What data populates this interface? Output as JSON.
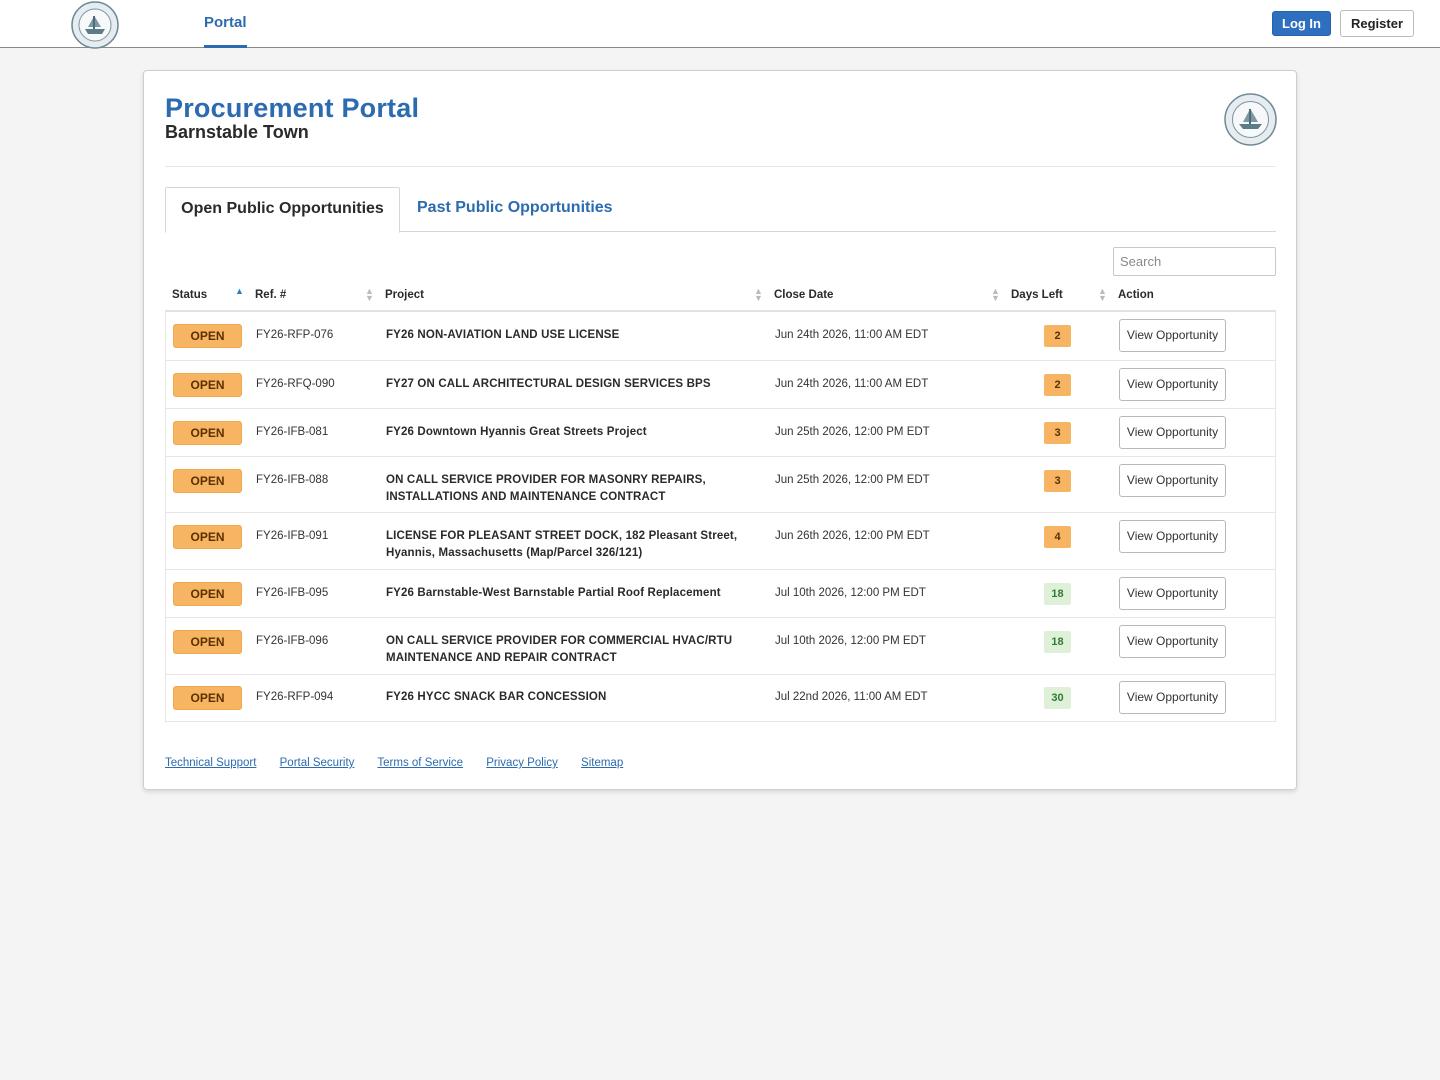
{
  "nav": {
    "portal_label": "Portal",
    "login_label": "Log In",
    "register_label": "Register"
  },
  "header": {
    "title": "Procurement Portal",
    "subtitle": "Barnstable Town"
  },
  "tabs": [
    {
      "label": "Open Public Opportunities",
      "active": true
    },
    {
      "label": "Past Public Opportunities",
      "active": false
    }
  ],
  "search": {
    "placeholder": "Search",
    "value": ""
  },
  "table": {
    "columns": [
      "Status",
      "Ref. #",
      "Project",
      "Close Date",
      "Days Left",
      "Action"
    ],
    "sorted_column": "Status",
    "rows": [
      {
        "status": "OPEN",
        "ref": "FY26-RFP-076",
        "project": "FY26 NON-AVIATION LAND USE LICENSE",
        "close_date": "Jun 24th 2026, 11:00 AM EDT",
        "days_left": "2",
        "action": "View Opportunity"
      },
      {
        "status": "OPEN",
        "ref": "FY26-RFQ-090",
        "project": "FY27 ON CALL ARCHITECTURAL DESIGN SERVICES BPS",
        "close_date": "Jun 24th 2026, 11:00 AM EDT",
        "days_left": "2",
        "action": "View Opportunity"
      },
      {
        "status": "OPEN",
        "ref": "FY26-IFB-081",
        "project": "FY26 Downtown Hyannis Great Streets Project",
        "close_date": "Jun 25th 2026, 12:00 PM EDT",
        "days_left": "3",
        "action": "View Opportunity"
      },
      {
        "status": "OPEN",
        "ref": "FY26-IFB-088",
        "project": "ON CALL SERVICE PROVIDER FOR MASONRY REPAIRS, INSTALLATIONS AND MAINTENANCE CONTRACT",
        "close_date": "Jun 25th 2026, 12:00 PM EDT",
        "days_left": "3",
        "action": "View Opportunity"
      },
      {
        "status": "OPEN",
        "ref": "FY26-IFB-091",
        "project": "LICENSE FOR PLEASANT STREET DOCK, 182 Pleasant Street, Hyannis, Massachusetts (Map/Parcel 326/121)",
        "close_date": "Jun 26th 2026, 12:00 PM EDT",
        "days_left": "4",
        "action": "View Opportunity"
      },
      {
        "status": "OPEN",
        "ref": "FY26-IFB-095",
        "project": "FY26 Barnstable-West Barnstable Partial Roof Replacement",
        "close_date": "Jul 10th 2026, 12:00 PM EDT",
        "days_left": "18",
        "action": "View Opportunity"
      },
      {
        "status": "OPEN",
        "ref": "FY26-IFB-096",
        "project": "ON CALL SERVICE PROVIDER FOR COMMERCIAL HVAC/RTU MAINTENANCE AND REPAIR CONTRACT",
        "close_date": "Jul 10th 2026, 12:00 PM EDT",
        "days_left": "18",
        "action": "View Opportunity"
      },
      {
        "status": "OPEN",
        "ref": "FY26-RFP-094",
        "project": "FY26 HYCC SNACK BAR CONCESSION",
        "close_date": "Jul 22nd 2026, 11:00 AM EDT",
        "days_left": "30",
        "action": "View Opportunity"
      }
    ]
  },
  "footer": {
    "links": [
      "Technical Support",
      "Portal Security",
      "Terms of Service",
      "Privacy Policy",
      "Sitemap"
    ]
  },
  "colors": {
    "brand_blue": "#2c6bb0",
    "open_badge": "#f7b462",
    "days_warning": "#f7b462",
    "days_ok": "#dff0d8"
  }
}
